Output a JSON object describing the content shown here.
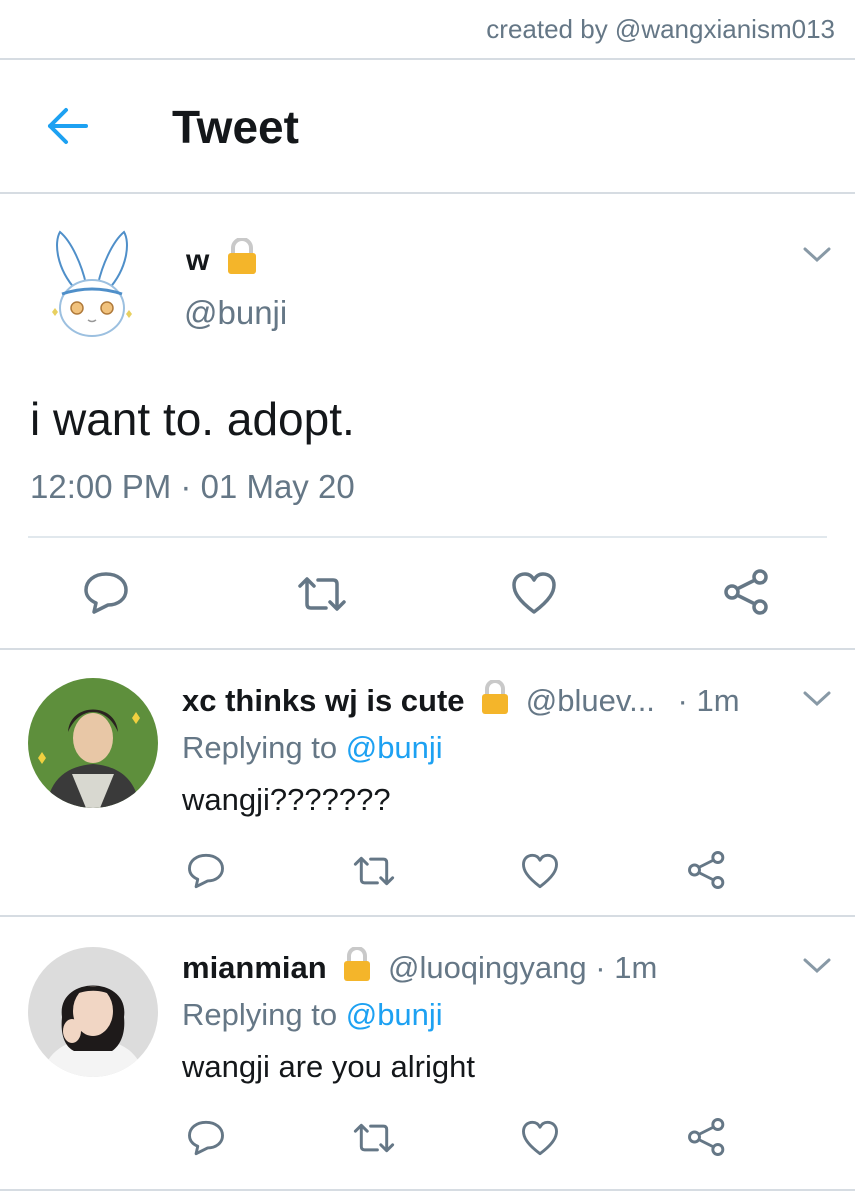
{
  "credit": "created by @wangxianism013",
  "header": {
    "title": "Tweet"
  },
  "tweet": {
    "name": "w",
    "handle": "@bunji",
    "text": "i want to. adopt.",
    "timestamp": "12:00 PM · 01 May 20"
  },
  "replies": [
    {
      "name": "xc thinks wj is cute",
      "handle": "@bluev...",
      "time": "· 1m",
      "replying_label": "Replying to",
      "replying_to": "@bunji",
      "text": "wangji???????"
    },
    {
      "name": "mianmian",
      "handle": "@luoqingyang",
      "time": "· 1m",
      "replying_label": "Replying to",
      "replying_to": "@bunji",
      "text": "wangji are you alright"
    }
  ],
  "colors": {
    "accent": "#1da1f2",
    "secondary_text": "#657786",
    "lock": "#f4b52a",
    "icon": "#657786"
  }
}
